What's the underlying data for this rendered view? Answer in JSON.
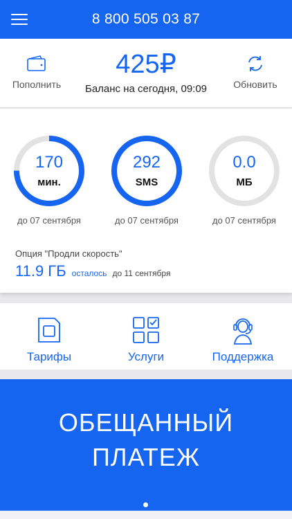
{
  "header": {
    "phone": "8 800 505 03 87"
  },
  "balance": {
    "topup_label": "Пополнить",
    "amount": "425₽",
    "note": "Баланс на сегодня, 09:09",
    "refresh_label": "Обновить"
  },
  "usage": {
    "gauges": [
      {
        "value": "170",
        "unit": "мин.",
        "date": "до 07 сентября",
        "fraction": 0.75
      },
      {
        "value": "292",
        "unit": "SMS",
        "date": "до 07 сентября",
        "fraction": 1.0
      },
      {
        "value": "0.0",
        "unit": "МБ",
        "date": "до 07 сентября",
        "fraction": 0.0
      }
    ],
    "option": {
      "title": "Опция \"Продли скорость\"",
      "amount": "11.9 ГБ",
      "left_label": "осталось",
      "until": "до 11 сентября"
    }
  },
  "nav": {
    "tariffs": "Тарифы",
    "services": "Услуги",
    "support": "Поддержка"
  },
  "banner": {
    "line1": "ОБЕЩАННЫЙ",
    "line2": "ПЛАТЕЖ"
  },
  "colors": {
    "accent": "#1565f0",
    "track": "#e2e2e2"
  }
}
